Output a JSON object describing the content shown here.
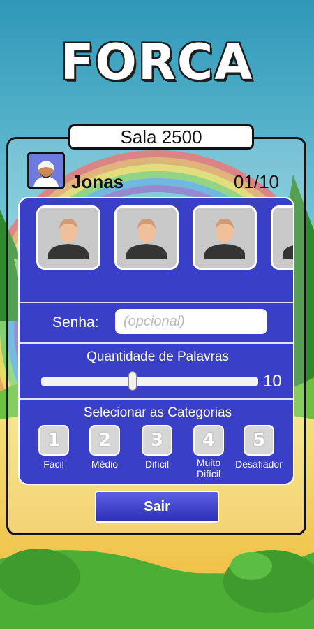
{
  "app": {
    "title": "FORCA"
  },
  "room": {
    "name": "Sala 2500"
  },
  "player": {
    "name": "Jonas",
    "count": "01/10"
  },
  "slots": [
    {
      "icon": "user-silhouette-icon"
    },
    {
      "icon": "user-silhouette-icon"
    },
    {
      "icon": "user-silhouette-icon"
    },
    {
      "icon": "user-silhouette-icon"
    }
  ],
  "password": {
    "label": "Senha:",
    "placeholder": "(opcional)"
  },
  "words": {
    "label": "Quantidade de Palavras",
    "value": "10",
    "slider_fraction": 0.42
  },
  "categories": {
    "label": "Selecionar as Categorias",
    "items": [
      {
        "number": "1",
        "name": "Fácil"
      },
      {
        "number": "2",
        "name": "Médio"
      },
      {
        "number": "3",
        "name": "Difícil"
      },
      {
        "number": "4",
        "name": "Muito\nDifícil"
      },
      {
        "number": "5",
        "name": "Desafiador"
      }
    ]
  },
  "actions": {
    "exit_label": "Sair"
  },
  "colors": {
    "panel": "#3a3fc8",
    "button": "#3438c0"
  }
}
